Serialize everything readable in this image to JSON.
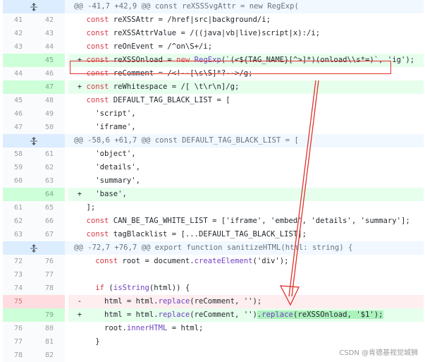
{
  "hunks": [
    {
      "header": "@@ -41,7 +42,9 @@ const reXSSSvgAttr = new RegExp("
    },
    {
      "header": "@@ -58,6 +61,7 @@ const DEFAULT_TAG_BLACK_LIST = ["
    },
    {
      "header": "@@ -72,7 +76,7 @@ export function sanitizeHTML(html: string) {"
    }
  ],
  "lines": [
    {
      "old": "41",
      "new": "42",
      "type": "ctx",
      "code": "    const reXSSAttr = /href|src|background/i;"
    },
    {
      "old": "42",
      "new": "43",
      "type": "ctx",
      "code": "    const reXSSAttrValue = /((java|vb|live)script|x):/i;"
    },
    {
      "old": "43",
      "new": "44",
      "type": "ctx",
      "code": "    const reOnEvent = /^on\\S+/i;"
    },
    {
      "old": "",
      "new": "45",
      "type": "add",
      "code": "  + const reXSSOnload = new RegExp(`(<${TAG_NAME}[^>]*)(onload\\\\s*=)`, 'ig');"
    },
    {
      "old": "44",
      "new": "46",
      "type": "ctx",
      "code": "    const reComment = /<!--[\\s\\S]*?-->/g;"
    },
    {
      "old": "",
      "new": "47",
      "type": "add",
      "code": "  + const reWhitespace = /[ \\t\\r\\n]/g;"
    },
    {
      "old": "45",
      "new": "48",
      "type": "ctx",
      "code": "    const DEFAULT_TAG_BLACK_LIST = ["
    },
    {
      "old": "46",
      "new": "49",
      "type": "ctx",
      "code": "      'script',"
    },
    {
      "old": "47",
      "new": "50",
      "type": "ctx",
      "code": "      'iframe',"
    },
    {
      "old": "58",
      "new": "61",
      "type": "ctx",
      "code": "      'object',"
    },
    {
      "old": "59",
      "new": "62",
      "type": "ctx",
      "code": "      'details',"
    },
    {
      "old": "60",
      "new": "63",
      "type": "ctx",
      "code": "      'summary',"
    },
    {
      "old": "",
      "new": "64",
      "type": "add",
      "code": "  +   'base',"
    },
    {
      "old": "61",
      "new": "65",
      "type": "ctx",
      "code": "    ];"
    },
    {
      "old": "62",
      "new": "66",
      "type": "ctx",
      "code": "    const CAN_BE_TAG_WHITE_LIST = ['iframe', 'embed', 'details', 'summary'];"
    },
    {
      "old": "63",
      "new": "67",
      "type": "ctx",
      "code": "    const tagBlacklist = [...DEFAULT_TAG_BLACK_LIST];"
    },
    {
      "old": "72",
      "new": "76",
      "type": "ctx",
      "code": "      const root = document.createElement('div');"
    },
    {
      "old": "73",
      "new": "77",
      "type": "ctx",
      "code": ""
    },
    {
      "old": "74",
      "new": "78",
      "type": "ctx",
      "code": "      if (isString(html)) {"
    },
    {
      "old": "75",
      "new": "",
      "type": "del",
      "code": "  -     html = html.replace(reComment, '');"
    },
    {
      "old": "",
      "new": "79",
      "type": "add",
      "code": "  +     html = html.replace(reComment, '').replace(reXSSOnload, '$1');"
    },
    {
      "old": "76",
      "new": "80",
      "type": "ctx",
      "code": "        root.innerHTML = html;"
    },
    {
      "old": "77",
      "new": "81",
      "type": "ctx",
      "code": "      }"
    },
    {
      "old": "78",
      "new": "82",
      "type": "ctx",
      "code": ""
    }
  ],
  "watermark": "CSDN @肯德基视觉城狮",
  "colors": {
    "annotation": "#e0312b",
    "add_bg": "#e6ffed",
    "del_bg": "#ffeef0",
    "hunk_bg": "#f1f8ff"
  },
  "icons": {
    "expand": "unfold-icon"
  }
}
